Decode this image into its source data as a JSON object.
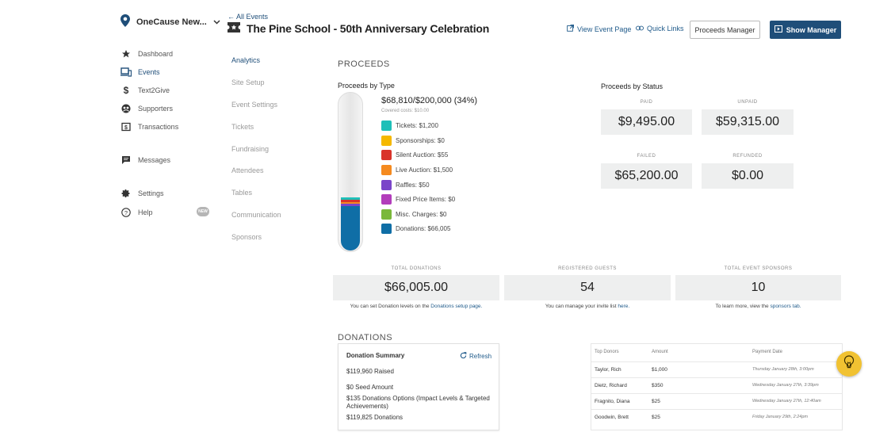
{
  "sidebar": {
    "org_name": "OneCause New...",
    "items": [
      {
        "label": "Dashboard"
      },
      {
        "label": "Events"
      },
      {
        "label": "Text2Give"
      },
      {
        "label": "Supporters"
      },
      {
        "label": "Transactions"
      },
      {
        "label": "Messages"
      },
      {
        "label": "Settings"
      },
      {
        "label": "Help"
      }
    ],
    "help_badge": "NEW"
  },
  "subnav": {
    "items": [
      "Analytics",
      "Site Setup",
      "Event Settings",
      "Tickets",
      "Fundraising",
      "Attendees",
      "Tables",
      "Communication",
      "Sponsors"
    ]
  },
  "header": {
    "back_label": "All Events",
    "title": "The Pine School - 50th Anniversary Celebration",
    "view_event_page": "View Event Page",
    "quick_links": "Quick Links",
    "proceeds_manager": "Proceeds Manager",
    "show_manager": "Show Manager"
  },
  "proceeds": {
    "heading": "PROCEEDS",
    "by_type_heading": "Proceeds by Type",
    "total": "$68,810/$200,000 (34%)",
    "covered_costs": "Covered costs: $10.00",
    "progress_fraction": 0.34,
    "legend": [
      {
        "label": "Tickets: $1,200",
        "color": "#1fbfb8",
        "value": 1200
      },
      {
        "label": "Sponsorships: $0",
        "color": "#f5b800",
        "value": 0
      },
      {
        "label": "Silent Auction: $55",
        "color": "#d9342b",
        "value": 55
      },
      {
        "label": "Live Auction: $1,500",
        "color": "#f58a1f",
        "value": 1500
      },
      {
        "label": "Raffles: $50",
        "color": "#7a45c9",
        "value": 50
      },
      {
        "label": "Fixed Price Items: $0",
        "color": "#b23dbb",
        "value": 0
      },
      {
        "label": "Misc. Charges: $0",
        "color": "#7ab83a",
        "value": 0
      },
      {
        "label": "Donations: $66,005",
        "color": "#0f6ea6",
        "value": 66005
      }
    ],
    "by_status_heading": "Proceeds by Status",
    "status": {
      "paid_label": "PAID",
      "paid_value": "$9,495.00",
      "unpaid_label": "UNPAID",
      "unpaid_value": "$59,315.00",
      "failed_label": "FAILED",
      "failed_value": "$65,200.00",
      "refunded_label": "REFUNDED",
      "refunded_value": "$0.00"
    }
  },
  "totals": {
    "donations_label": "TOTAL DONATIONS",
    "donations_value": "$66,005.00",
    "donations_note_pre": "You can set Donation levels on the ",
    "donations_note_link": "Donations setup page.",
    "guests_label": "REGISTERED GUESTS",
    "guests_value": "54",
    "guests_note_pre": "You can manage your invite list ",
    "guests_note_link": "here.",
    "sponsors_label": "TOTAL EVENT SPONSORS",
    "sponsors_value": "10",
    "sponsors_note_pre": "To learn more, view the ",
    "sponsors_note_link": "sponsors tab."
  },
  "donations": {
    "heading": "DONATIONS",
    "summary_title": "Donation Summary",
    "refresh": "Refresh",
    "raised": "$119,960 Raised",
    "seed": "$0 Seed Amount",
    "options": "$135 Donations Options (Impact Levels & Targeted Achievements)",
    "donations": "$119,825 Donations",
    "table_headers": [
      "Top Donors",
      "Amount",
      "Payment Date"
    ],
    "rows": [
      {
        "name": "Taylor, Rich",
        "amount": "$1,000",
        "date": "Thursday January 28th, 3:00pm"
      },
      {
        "name": "Dietz, Richard",
        "amount": "$350",
        "date": "Wednesday January 27th, 3:39pm"
      },
      {
        "name": "Fragnito, Diana",
        "amount": "$25",
        "date": "Wednesday January 27th, 12:40am"
      },
      {
        "name": "Goodwin, Brett",
        "amount": "$25",
        "date": "Friday January 29th, 2:24pm"
      }
    ]
  }
}
